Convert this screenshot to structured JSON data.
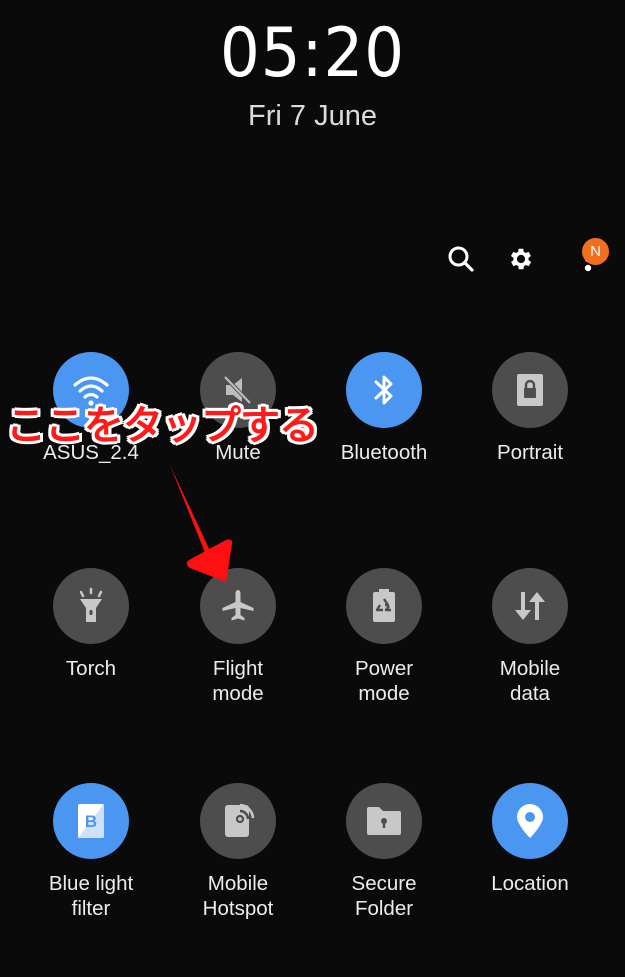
{
  "lockscreen": {
    "time": "05:20",
    "date": "Fri 7 June"
  },
  "toolbar": {
    "search_icon": "search-icon",
    "settings_icon": "gear-icon",
    "more_icon": "more-vertical-icon",
    "notification_badge": "N",
    "badge_color": "#f07020"
  },
  "annotation": {
    "text": "ここをタップする",
    "color": "#ff1a1a",
    "arrow_target": "Flight mode"
  },
  "colors": {
    "tile_on": "#4a96f0",
    "tile_off": "#4d4d4d",
    "background": "#0a0a0a"
  },
  "tiles": [
    {
      "label": "ASUS_2.4",
      "icon": "wifi-icon",
      "state": "on"
    },
    {
      "label": "Mute",
      "icon": "mute-icon",
      "state": "off"
    },
    {
      "label": "Bluetooth",
      "icon": "bluetooth-icon",
      "state": "on"
    },
    {
      "label": "Portrait",
      "icon": "portrait-lock-icon",
      "state": "off"
    },
    {
      "label": "Torch",
      "icon": "torch-icon",
      "state": "off"
    },
    {
      "label": "Flight\nmode",
      "label_line1": "Flight",
      "label_line2": "mode",
      "icon": "airplane-icon",
      "state": "off"
    },
    {
      "label": "Power\nmode",
      "label_line1": "Power",
      "label_line2": "mode",
      "icon": "power-mode-icon",
      "state": "off"
    },
    {
      "label": "Mobile\ndata",
      "label_line1": "Mobile",
      "label_line2": "data",
      "icon": "mobile-data-icon",
      "state": "off"
    },
    {
      "label": "Blue light\nfilter",
      "label_line1": "Blue light",
      "label_line2": "filter",
      "icon": "blue-light-filter-icon",
      "state": "on"
    },
    {
      "label": "Mobile\nHotspot",
      "label_line1": "Mobile",
      "label_line2": "Hotspot",
      "icon": "hotspot-icon",
      "state": "off"
    },
    {
      "label": "Secure\nFolder",
      "label_line1": "Secure",
      "label_line2": "Folder",
      "icon": "secure-folder-icon",
      "state": "off"
    },
    {
      "label": "Location",
      "icon": "location-icon",
      "state": "on"
    }
  ]
}
